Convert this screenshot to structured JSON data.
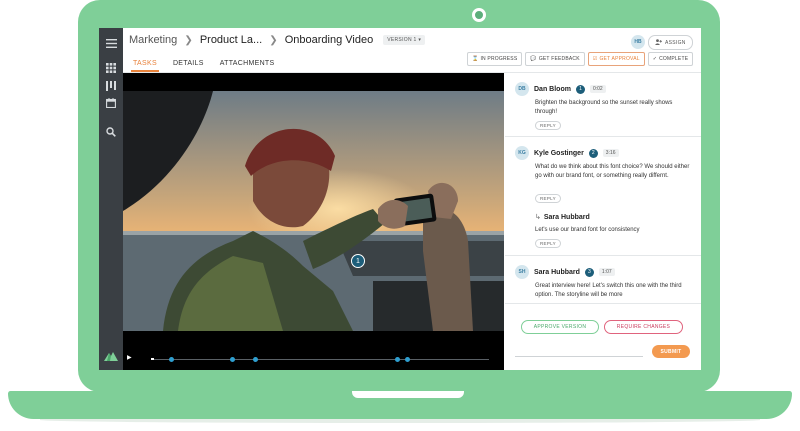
{
  "breadcrumb": {
    "items": [
      "Marketing",
      "Product La...",
      "Onboarding Video"
    ],
    "version": "VERSION 1 ▾"
  },
  "tabs": [
    {
      "label": "TASKS",
      "active": true
    },
    {
      "label": "DETAILS",
      "active": false
    },
    {
      "label": "ATTACHMENTS",
      "active": false
    }
  ],
  "header": {
    "user_initials": "HB",
    "assign_label": "ASSIGN"
  },
  "actions": {
    "in_progress": "IN PROGRESS",
    "get_feedback": "GET FEEDBACK",
    "get_approval": "GET APPROVAL",
    "complete": "COMPLETE"
  },
  "video": {
    "pin_number": "1",
    "progress_fraction": 0.01,
    "markers": [
      0.06,
      0.24,
      0.31,
      0.73,
      0.76
    ]
  },
  "comments": [
    {
      "initials": "DB",
      "name": "Dan Bloom",
      "number": "1",
      "time": "0:02",
      "text": "Brighten the background so the sunset really shows through!",
      "reply": "REPLY"
    },
    {
      "initials": "KG",
      "name": "Kyle Gostinger",
      "number": "2",
      "time": "3:16",
      "text": "What do we think about this font choice? We should either go with our brand font, or something really differnt.",
      "reply": "REPLY",
      "sub_reply": {
        "name": "Sara Hubbard",
        "text": "Let's use our brand font for consistency",
        "reply": "REPLY"
      }
    },
    {
      "initials": "SH",
      "name": "Sara Hubbard",
      "number": "3",
      "time": "1:07",
      "text": "Great interview here! Let's switch this one with the third option. The storyline will be more"
    }
  ],
  "decision": {
    "approve": "APPROVE VERSION",
    "require": "REQUIRE CHANGES",
    "submit": "SUBMIT"
  },
  "colors": {
    "accent": "#e8823b",
    "sidebar": "#3a3f44",
    "laptop": "#7fcf98",
    "pin": "#1d5e7a"
  }
}
